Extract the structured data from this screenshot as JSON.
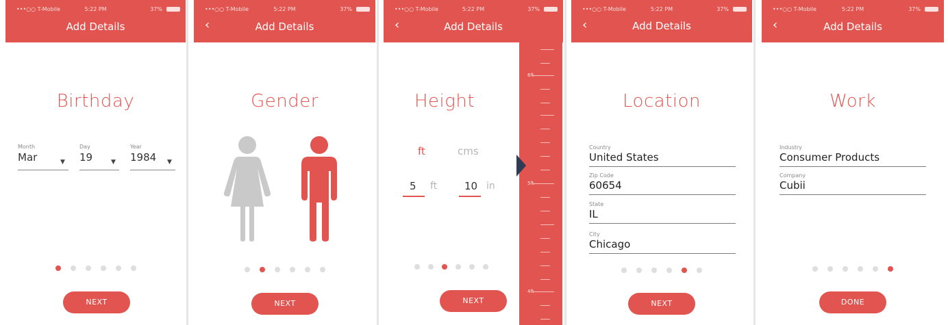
{
  "status_bar": {
    "carrier": "•••○○ T-Mobile",
    "time": "5:22 PM",
    "battery": "37%"
  },
  "header_title": "Add Details",
  "screens": {
    "birthday": {
      "heading": "Birthday",
      "fields": [
        {
          "label": "Month",
          "value": "Mar"
        },
        {
          "label": "Day",
          "value": "19"
        },
        {
          "label": "Year",
          "value": "1984"
        }
      ],
      "button": "NEXT",
      "active_step": 1
    },
    "gender": {
      "heading": "Gender",
      "options": [
        "female",
        "male"
      ],
      "selected": "male",
      "button": "NEXT",
      "active_step": 2
    },
    "height": {
      "heading": "Height",
      "units": [
        "ft",
        "cms"
      ],
      "selected_unit": "ft",
      "feet": "5",
      "feet_unit": "ft",
      "inches": "10",
      "inches_unit": "in",
      "ruler_labels": [
        "6ft",
        "5ft",
        "4ft"
      ],
      "button": "NEXT",
      "active_step": 3
    },
    "location": {
      "heading": "Location",
      "fields": [
        {
          "label": "Country",
          "value": "United States"
        },
        {
          "label": "Zip Code",
          "value": "60654"
        },
        {
          "label": "State",
          "value": "IL"
        },
        {
          "label": "City",
          "value": "Chicago"
        }
      ],
      "button": "NEXT",
      "active_step": 5
    },
    "work": {
      "heading": "Work",
      "fields": [
        {
          "label": "Industry",
          "value": "Consumer Products"
        },
        {
          "label": "Company",
          "value": "Cubii"
        }
      ],
      "button": "DONE",
      "active_step": 6
    }
  },
  "total_steps": 6,
  "colors": {
    "accent": "#e2544f",
    "inactive_dot": "#dedede",
    "figure_inactive": "#c9c9c9",
    "pointer": "#2f3b55"
  },
  "icons": {
    "back": "chevron-left-icon",
    "dropdown": "caret-down-icon"
  }
}
